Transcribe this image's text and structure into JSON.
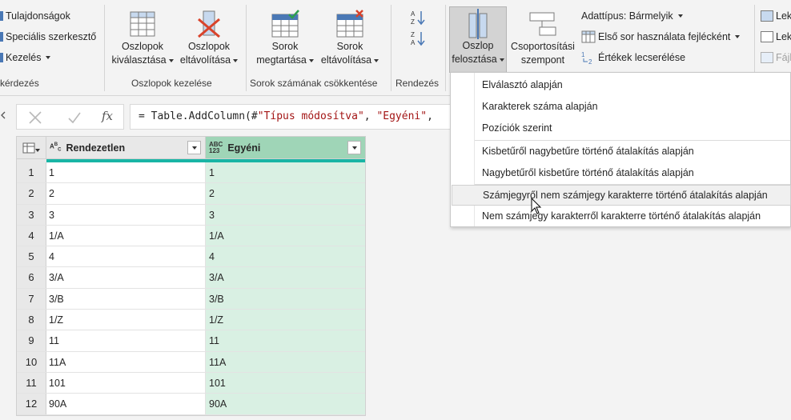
{
  "ribbon": {
    "left_partial": {
      "properties": "Tulajdonságok",
      "advanced_editor": "Speciális szerkesztő",
      "manage": "Kezelés",
      "group_label": "kérdezés"
    },
    "manage_columns": {
      "choose_label_1": "Oszlopok",
      "choose_label_2": "kiválasztása",
      "remove_label_1": "Oszlopok",
      "remove_label_2": "eltávolítása",
      "group_label": "Oszlopok kezelése"
    },
    "reduce_rows": {
      "keep_label_1": "Sorok",
      "keep_label_2": "megtartása",
      "remove_label_1": "Sorok",
      "remove_label_2": "eltávolítása",
      "group_label": "Sorok számának csökkentése"
    },
    "sort": {
      "group_label": "Rendezés"
    },
    "transform": {
      "split_label_1": "Oszlop",
      "split_label_2": "felosztása",
      "groupby_label_1": "Csoportosítási",
      "groupby_label_2": "szempont",
      "datatype": "Adattípus: Bármelyik",
      "first_row_header": "Első sor használata fejlécként",
      "replace_values": "Értékek lecserélése"
    },
    "right_partial": {
      "item1": "Lek",
      "item2": "Lek",
      "item3": "Fájl"
    }
  },
  "formula": {
    "prefix": "= Table.AddColumn(#",
    "str1": "\"Típus módosítva\"",
    "sep": ", ",
    "str2": "\"Egyéni\"",
    "suffix": ","
  },
  "table": {
    "columns": [
      {
        "name": "Rendezetlen",
        "type_icon": "ABC"
      },
      {
        "name": "Egyéni",
        "type_icon": "ABC 123"
      }
    ],
    "rows": [
      {
        "n": "1",
        "a": "1",
        "b": "1"
      },
      {
        "n": "2",
        "a": "2",
        "b": "2"
      },
      {
        "n": "3",
        "a": "3",
        "b": "3"
      },
      {
        "n": "4",
        "a": "1/A",
        "b": "1/A"
      },
      {
        "n": "5",
        "a": "4",
        "b": "4"
      },
      {
        "n": "6",
        "a": "3/A",
        "b": "3/A"
      },
      {
        "n": "7",
        "a": "3/B",
        "b": "3/B"
      },
      {
        "n": "8",
        "a": "1/Z",
        "b": "1/Z"
      },
      {
        "n": "9",
        "a": "11",
        "b": "11"
      },
      {
        "n": "10",
        "a": "11A",
        "b": "11A"
      },
      {
        "n": "11",
        "a": "101",
        "b": "101"
      },
      {
        "n": "12",
        "a": "90A",
        "b": "90A"
      }
    ]
  },
  "split_menu": {
    "items": [
      "Elválasztó alapján",
      "Karakterek száma alapján",
      "Pozíciók szerint",
      "Kisbetűről nagybetűre történő átalakítás alapján",
      "Nagybetűről kisbetűre történő átalakítás alapján",
      "Számjegyről nem számjegy karakterre történő átalakítás alapján",
      "Nem számjegy karakterről karakterre történő átalakítás alapján"
    ],
    "hovered_index": 5
  },
  "colors": {
    "accent_green": "#9fd5b7",
    "quality_bar": "#19b5a5",
    "selected_cell": "#d9f0e3"
  }
}
